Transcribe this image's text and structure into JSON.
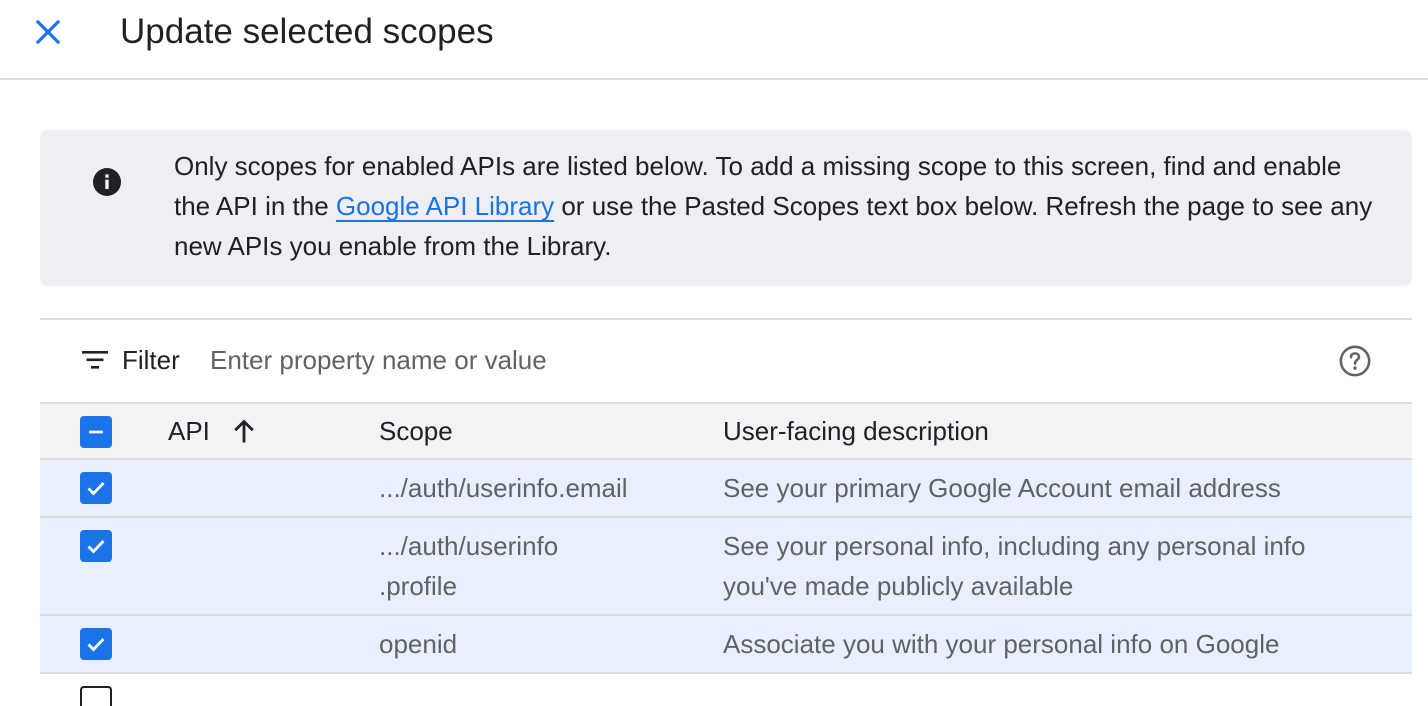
{
  "header": {
    "title": "Update selected scopes"
  },
  "info": {
    "text_before": "Only scopes for enabled APIs are listed below. To add a missing scope to this screen, find and enable the API in the ",
    "link_text": "Google API Library",
    "text_after": " or use the Pasted Scopes text box below. Refresh the page to see any new APIs you enable from the Library."
  },
  "filter": {
    "label": "Filter",
    "placeholder": "Enter property name or value"
  },
  "table": {
    "columns": {
      "api": "API",
      "scope": "Scope",
      "description": "User-facing description"
    },
    "rows": [
      {
        "api": "",
        "scope": ".../auth/userinfo.email",
        "description": "See your primary Google Account email address",
        "checked": true
      },
      {
        "api": "",
        "scope": ".../auth/userinfo .profile",
        "description": "See your personal info, including any personal info you've made publicly available",
        "checked": true
      },
      {
        "api": "",
        "scope": "openid",
        "description": "Associate you with your personal info on Google",
        "checked": true
      }
    ]
  },
  "colors": {
    "accent": "#1a73e8",
    "row_selected": "#e8f0fe",
    "info_bg": "#edeff3"
  }
}
